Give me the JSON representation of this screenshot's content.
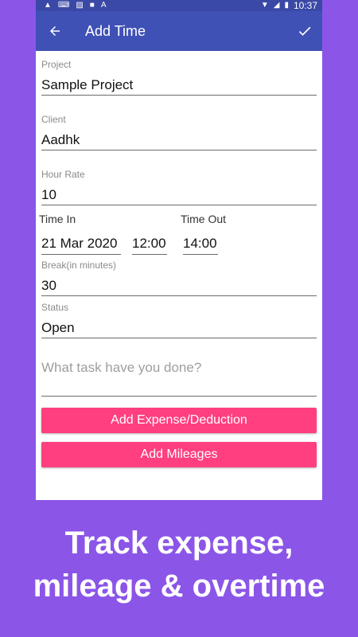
{
  "statusbar": {
    "time": "10:37",
    "icons": [
      "warning-icon",
      "keyboard-icon",
      "image-icon",
      "sd-card-icon",
      "a-icon",
      "wifi-icon",
      "signal-icon",
      "battery-icon"
    ]
  },
  "appbar": {
    "title": "Add Time",
    "back_icon": "arrow-left-icon",
    "save_icon": "check-icon"
  },
  "form": {
    "project": {
      "label": "Project",
      "value": "Sample Project"
    },
    "client": {
      "label": "Client",
      "value": "Aadhk"
    },
    "hour_rate": {
      "label": "Hour Rate",
      "value": "10"
    },
    "time_in": {
      "label": "Time In",
      "date": "21 Mar 2020",
      "time": "12:00"
    },
    "time_out": {
      "label": "Time Out",
      "time": "14:00"
    },
    "break": {
      "label": "Break(in minutes)",
      "value": "30"
    },
    "status": {
      "label": "Status",
      "value": "Open"
    },
    "task": {
      "placeholder": "What task have you done?"
    }
  },
  "buttons": {
    "add_expense": "Add Expense/Deduction",
    "add_mileages": "Add Mileages"
  },
  "caption": {
    "line1": "Track expense,",
    "line2": "mileage & overtime"
  },
  "colors": {
    "background": "#8B55E8",
    "appbar": "#3F51B5",
    "statusbar": "#3a48a6",
    "button": "#FF3F7F"
  }
}
